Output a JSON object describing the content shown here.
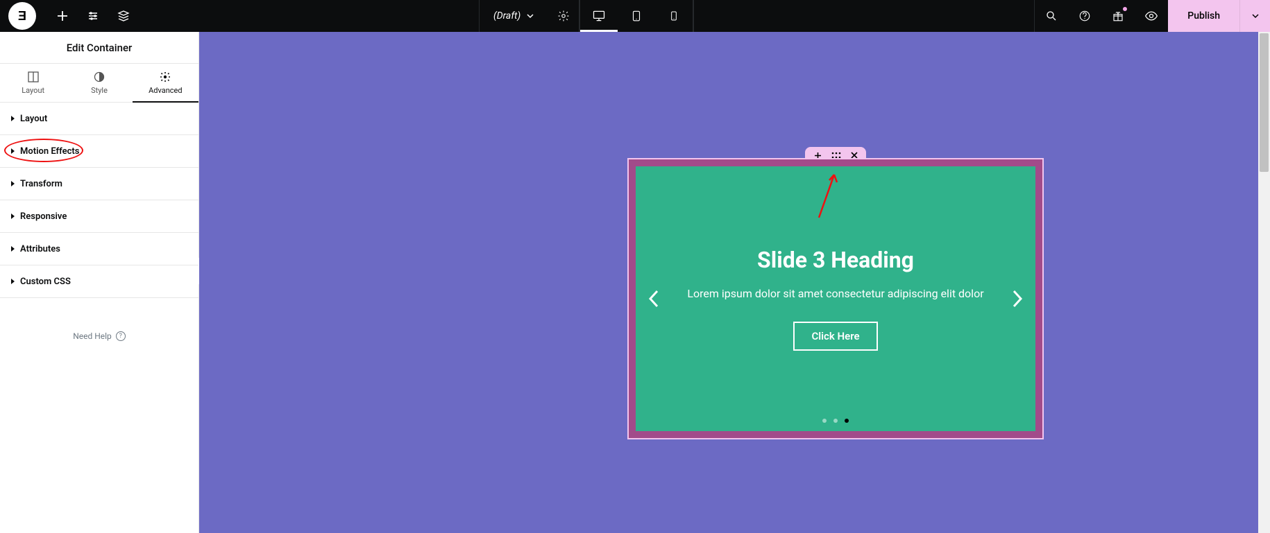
{
  "topbar": {
    "draft_label": "(Draft)",
    "publish_label": "Publish"
  },
  "sidebar": {
    "title": "Edit Container",
    "tabs": {
      "layout": "Layout",
      "style": "Style",
      "advanced": "Advanced"
    },
    "sections": {
      "layout": "Layout",
      "motion_effects": "Motion Effects",
      "transform": "Transform",
      "responsive": "Responsive",
      "attributes": "Attributes",
      "custom_css": "Custom CSS"
    },
    "need_help": "Need Help"
  },
  "slide": {
    "heading": "Slide 3 Heading",
    "body": "Lorem ipsum dolor sit amet consectetur adipiscing elit dolor",
    "button": "Click Here"
  }
}
